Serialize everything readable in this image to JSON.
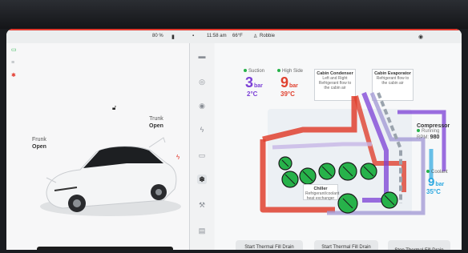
{
  "status_bar": {
    "battery": "80 %",
    "time": "11:58 am",
    "temperature": "66°F",
    "user": "Robbie"
  },
  "left_panel": {
    "frunk_label": "Frunk",
    "frunk_state": "Open",
    "trunk_label": "Trunk",
    "trunk_state": "Open"
  },
  "thermal": {
    "suction_label": "Suction",
    "suction_value": "3",
    "suction_unit": "bar",
    "suction_temp": "2°C",
    "highside_label": "High Side",
    "highside_value": "9",
    "highside_unit": "bar",
    "highside_temp": "39°C",
    "cabin_condenser_title": "Cabin Condenser",
    "cabin_condenser_text": "Left and Right Refrigerant flow to the cabin air",
    "cabin_evaporator_title": "Cabin Evaporator",
    "cabin_evaporator_text": "Refrigerant flow to the cabin air",
    "compressor_title": "Compressor",
    "compressor_status": "Running",
    "compressor_rpm_label": "RPM:",
    "compressor_rpm": "980",
    "chiller_title": "Chiller",
    "chiller_text": "Refrigerant/coolant heat exchanger",
    "coolant_label": "Coolant",
    "coolant_value": "9",
    "coolant_unit": "bar",
    "coolant_temp": "35°C"
  },
  "buttons": {
    "fill_drain_both": "Start Thermal Fill Drain (Coolant + Refrigerant)",
    "fill_drain_refrigerant": "Start Thermal Fill Drain (Refrigerant only)",
    "stop_fill_drain": "Stop Thermal Fill Drain"
  },
  "colors": {
    "red_accent": "#e33a2f",
    "suction_purple": "#7b3fd6",
    "highside_red": "#e0412f",
    "coolant_blue": "#2aa7e0",
    "valve_green": "#27b24a"
  },
  "icons": {
    "rail": [
      "car-icon",
      "steering-icon",
      "tire-icon",
      "lightning-icon",
      "display-icon",
      "thermal-icon",
      "wrench-icon",
      "document-icon"
    ]
  }
}
